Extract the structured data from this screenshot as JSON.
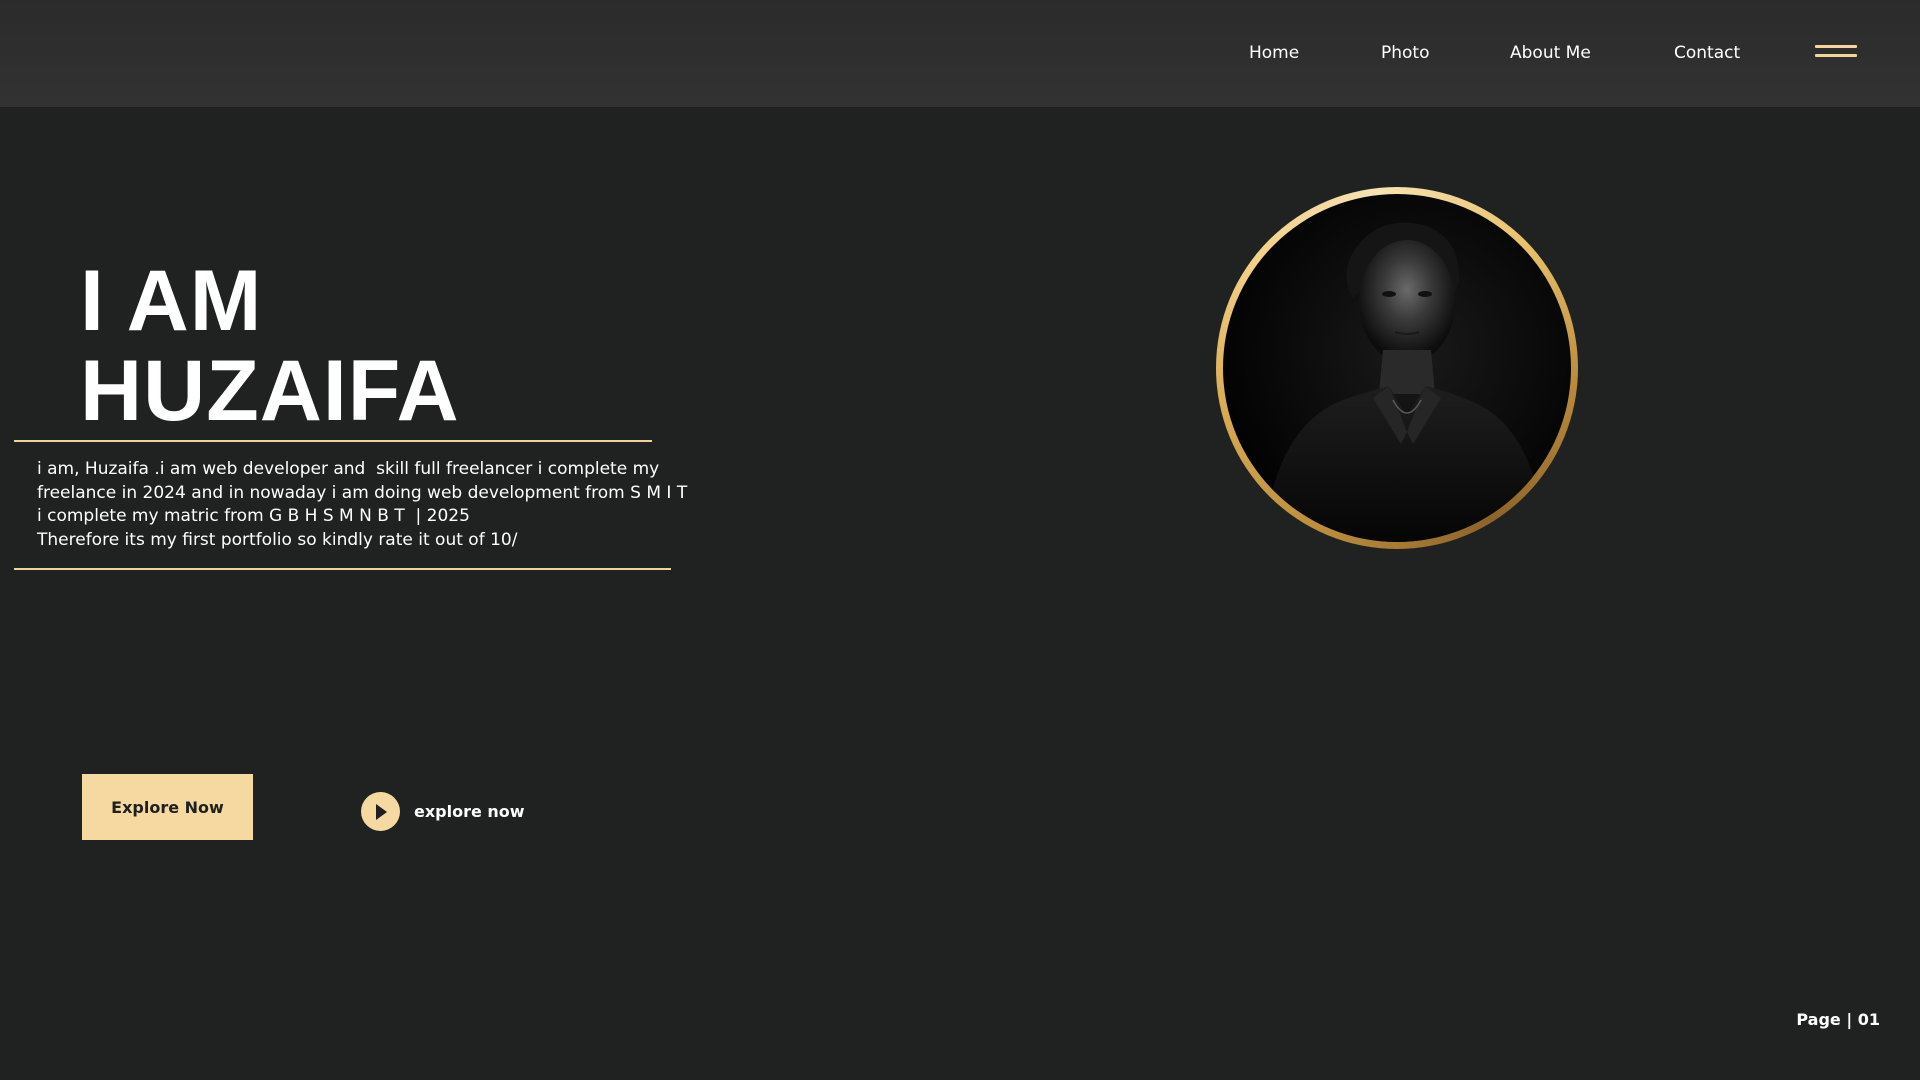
{
  "nav": {
    "items": [
      {
        "label": "Home"
      },
      {
        "label": "Photo"
      },
      {
        "label": "About Me"
      },
      {
        "label": "Contact"
      }
    ],
    "menu_icon": "hamburger-icon"
  },
  "hero": {
    "title_line1": "I AM",
    "title_line2": "HUZAIFA",
    "bio": [
      "i am, Huzaifa .i am web developer and  skill full freelancer i complete my",
      "freelance in 2024 and in nowaday i am doing web development from S M I T",
      "i complete my matric from G B H S M N B T  | 2025",
      "Therefore its my first portfolio so kindly rate it out of 10/"
    ],
    "primary_button": "Explore Now",
    "secondary_link": "explore now",
    "secondary_icon": "play-icon"
  },
  "footer": {
    "page_label": "Page | 01"
  },
  "colors": {
    "background": "#202221",
    "header": "#2f2f2f",
    "accent": "#f5d9a0",
    "text": "#ffffff"
  }
}
